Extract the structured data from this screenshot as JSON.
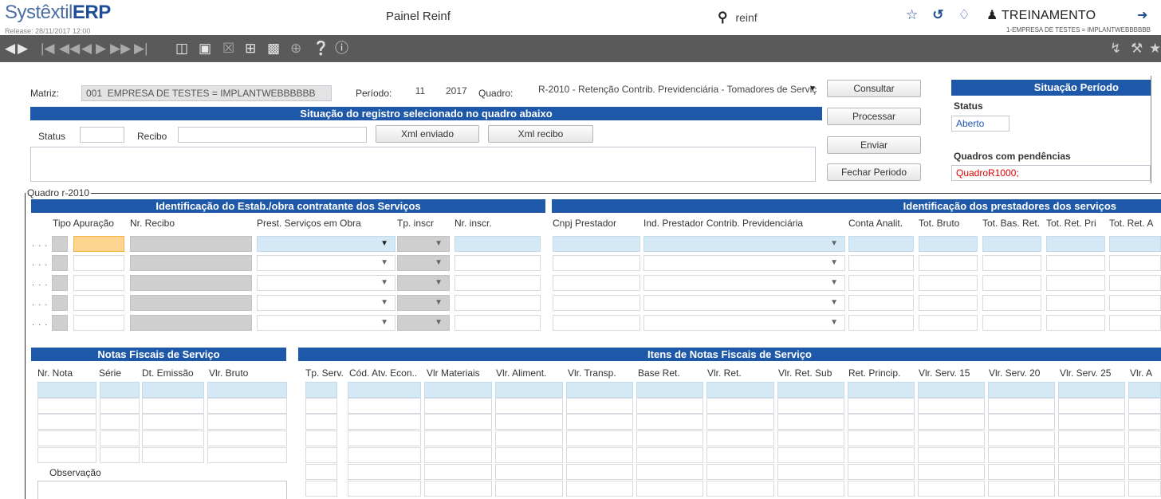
{
  "header": {
    "logo_light": "Systêxtil",
    "logo_bold": "ERP",
    "release": "Release: 28/11/2017 12:00",
    "title": "Painel Reinf",
    "search_value": "reinf",
    "user": "TREINAMENTO",
    "company": "1-EMPRESA DE TESTES = IMPLANTWEBBBBBB",
    "icons": [
      "search-icon",
      "star-icon",
      "history-icon",
      "bell-icon",
      "user-icon",
      "logout-icon"
    ]
  },
  "toolbar": {
    "icons": [
      "nav-prev-icon",
      "nav-next-icon",
      "first-icon",
      "rewind-icon",
      "back-icon",
      "forward-icon",
      "fast-forward-icon",
      "last-icon",
      "new-icon",
      "save-icon",
      "delete-icon",
      "add-icon",
      "search-record-icon",
      "zoom-icon",
      "help-icon",
      "info-icon",
      "flash-icon",
      "tools-icon",
      "favorite-icon"
    ]
  },
  "filters": {
    "matriz_label": "Matriz:",
    "matriz_code": "001",
    "matriz_name": "EMPRESA DE TESTES = IMPLANTWEBBBBBB",
    "periodo_label": "Período:",
    "periodo_mes": "11",
    "periodo_ano": "2017",
    "quadro_label": "Quadro:",
    "quadro_value": "R-2010 - Retenção Contrib. Previdenciária - Tomadores de Serviç"
  },
  "actions": {
    "consultar": "Consultar",
    "processar": "Processar",
    "enviar": "Enviar",
    "fechar": "Fechar Periodo"
  },
  "situacao_periodo": {
    "title": "Situação Período",
    "status_label": "Status",
    "status_value": "Aberto",
    "pendencias_label": "Quadros com pendências",
    "pendencias_value": "QuadroR1000;"
  },
  "registro": {
    "title": "Situação do registro selecionado no quadro abaixo",
    "status_label": "Status",
    "recibo_label": "Recibo",
    "xml_enviado": "Xml enviado",
    "xml_recibo": "Xml recibo"
  },
  "quadro": {
    "legend": "Quadro r-2010",
    "estab_title": "Identificação do Estab./obra contratante dos Serviços",
    "prest_title": "Identificação dos prestadores dos serviços",
    "estab_cols": [
      "Tipo Apuração",
      "Nr. Recibo",
      "Prest. Serviços em Obra",
      "Tp. inscr",
      "Nr. inscr."
    ],
    "prest_cols": [
      "Cnpj Prestador",
      "Ind. Prestador Contrib. Previdenciária",
      "Conta Analit.",
      "Tot. Bruto",
      "Tot. Bas. Ret.",
      "Tot. Ret. Pri",
      "Tot. Ret. A"
    ],
    "row_dots": ". . ."
  },
  "notas": {
    "title": "Notas Fiscais de Serviço",
    "cols": [
      "Nr. Nota",
      "Série",
      "Dt. Emissão",
      "Vlr. Bruto"
    ],
    "obs_label": "Observação"
  },
  "itens": {
    "title": "Itens de Notas Fiscais de Serviço",
    "cols": [
      "Tp. Serv.",
      "Cód. Atv. Econ..",
      "Vlr Materiais",
      "Vlr. Aliment.",
      "Vlr. Transp.",
      "Base Ret.",
      "Vlr. Ret.",
      "Vlr. Ret. Sub",
      "Ret. Princip.",
      "Vlr. Serv. 15",
      "Vlr. Serv. 20",
      "Vlr. Serv. 25",
      "Vlr. A"
    ]
  }
}
